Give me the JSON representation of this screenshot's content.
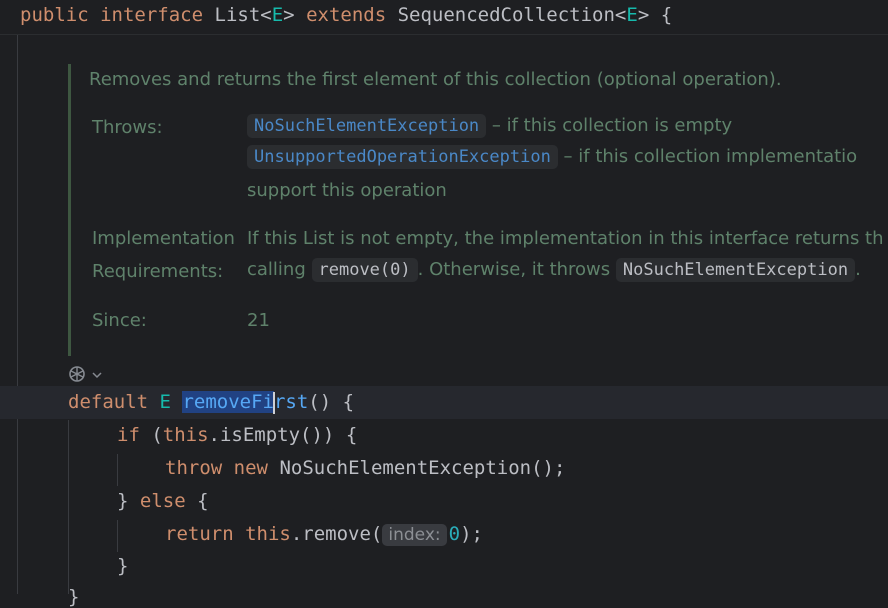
{
  "header": {
    "kw_public": "public",
    "kw_interface": "interface",
    "type_name": "List<",
    "type_param": "E",
    "type_close": ">",
    "kw_extends": "extends",
    "super_name": "SequencedCollection<",
    "super_param": "E",
    "super_close": "> {"
  },
  "doc": {
    "summary": "Removes and returns the first element of this collection (optional operation).",
    "throws_label": "Throws:",
    "throws": [
      {
        "exception": "NoSuchElementException",
        "text": " – if this collection is empty"
      },
      {
        "exception": "UnsupportedOperationException",
        "text": " – if this collection implementatio"
      }
    ],
    "throws_cont": "support this operation",
    "impl_label_1": "Implementation",
    "impl_label_2": "Requirements:",
    "impl_line1": "If this List is not empty, the implementation in this interface returns th",
    "impl_line2_a": "calling ",
    "impl_code_1": "remove(0)",
    "impl_line2_b": ". Otherwise, it throws ",
    "impl_code_2": "NoSuchElementException",
    "impl_line2_c": ".",
    "since_label": "Since:",
    "since_value": "21"
  },
  "code": {
    "l1_default": "default",
    "l1_E": "E",
    "l1_sel": "removeFi",
    "l1_rest_fn": "rst",
    "l1_tail": "() {",
    "l2_if": "if",
    "l2_open": " (",
    "l2_this": "this",
    "l2_rest": ".isEmpty()) {",
    "l3_throw": "throw",
    "l3_new": "new",
    "l3_rest": "NoSuchElementException();",
    "l4_close": "} ",
    "l4_else": "else",
    "l4_brace": " {",
    "l5_return": "return",
    "l5_this": "this",
    "l5_call": ".remove(",
    "l5_hint": "index:",
    "l5_num": "0",
    "l5_end": ");",
    "l6": "}",
    "l7": "}"
  },
  "icons": {
    "gutter": "override-method-icon",
    "chevron": "chevron-down-icon"
  },
  "colors": {
    "background": "#1e1f22",
    "keyword": "#cf8e6d",
    "type_param": "#16baac",
    "method": "#56a8f5",
    "doc_text": "#5f826b",
    "doc_link": "#4a88c7",
    "selection": "#214283"
  }
}
